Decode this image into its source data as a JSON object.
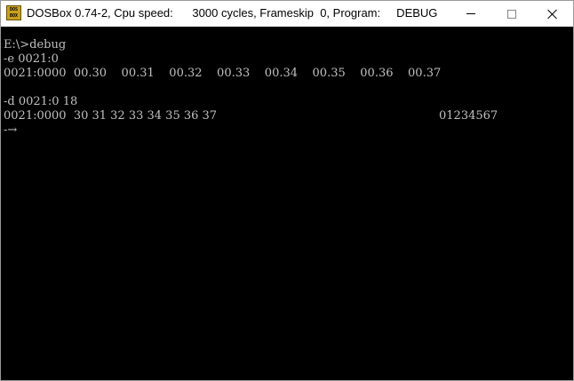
{
  "window": {
    "title": "DOSBox 0.74-2, Cpu speed:      3000 cycles, Frameskip  0, Program:     DEBUG",
    "icon_label": "DOS BOX"
  },
  "console": {
    "lines": {
      "prompt_debug": "E:\\>debug",
      "cmd_e": "-e 0021:0",
      "e_output": "0021:0000  00.30    00.31    00.32    00.33    00.34    00.35    00.36    00.37",
      "cmd_d": "-d 0021:0 18",
      "d_output_hex": "0021:0000  30 31 32 33 34 35 36 37",
      "d_output_ascii": "01234567",
      "cursor_prompt": "-→"
    }
  },
  "colors": {
    "console_bg": "#000000",
    "console_fg": "#c0c0c0",
    "titlebar_bg": "#ffffff"
  }
}
